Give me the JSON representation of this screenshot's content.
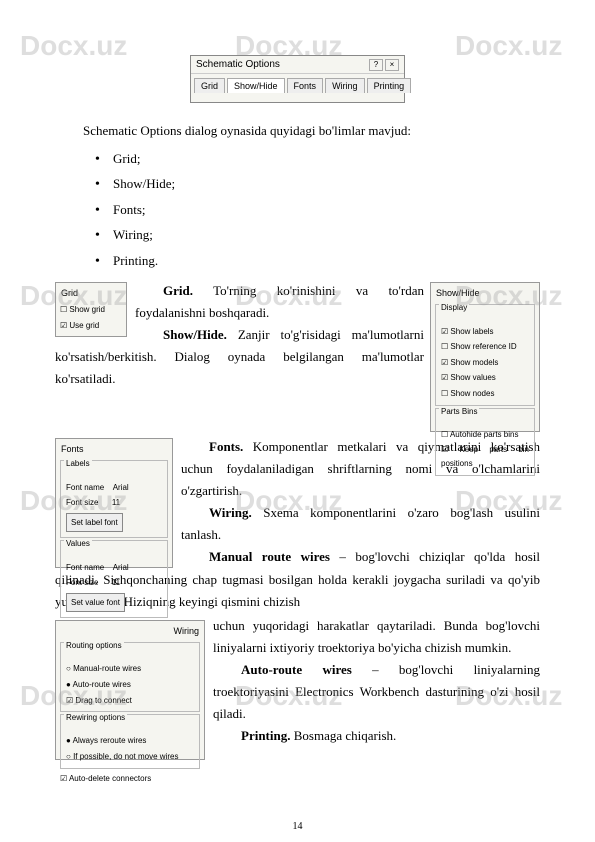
{
  "watermark": "Docx.uz",
  "schematic_dialog": {
    "title": "Schematic Options",
    "tabs": [
      "Grid",
      "Show/Hide",
      "Fonts",
      "Wiring",
      "Printing"
    ]
  },
  "intro": "Schematic Options dialog oynasida quyidagi bo'limlar mavjud:",
  "bullets": {
    "b1": "Grid;",
    "b2": "Show/Hide;",
    "b3": "Fonts;",
    "b4": "Wiring;",
    "b5": "Printing."
  },
  "sections": {
    "grid": {
      "title": "Grid.",
      "text": "To'rning ko'rinishini va to'rdan foydalanishni boshqaradi."
    },
    "showhide": {
      "title": "Show/Hide.",
      "text": "Zanjir to'g'risidagi ma'lumotlarni ko'rsatish/berkitish. Dialog oynada belgilangan ma'lumotlar ko'rsatiladi."
    },
    "fonts": {
      "title": "Fonts.",
      "text": "Komponentlar metkalari va qiymatlarini ko'rsatish uchun foydalaniladigan shriftlarning nomi va o'lchamlarini o'zgartirish."
    },
    "wiring": {
      "title": "Wiring.",
      "text": "Sxema komponentlarini o'zaro bog'lash usulini tanlash."
    },
    "manual": {
      "title": "Manual route wires",
      "text1": " – bog'lovchi chiziqlar qo'lda hosil qilinadi. Sichqonchaning chap tugmasi bosilgan holda kerakli joygacha suriladi va qo'yib yuboriladi. CHiziqning keyingi qismini chizish",
      "text2": "uchun yuqoridagi harakatlar qaytariladi. Bunda bog'lovchi liniyalarni ixtiyoriy troektoriya bo'yicha chizish mumkin."
    },
    "auto": {
      "title": "Auto-route wires",
      "text": " – bog'lovchi liniyalarning troektoriyasini Electronics Workbench dasturining o'zi hosil qiladi."
    },
    "printing": {
      "title": "Printing.",
      "text": "Bosmaga chiqarish."
    }
  },
  "panels": {
    "grid": {
      "title": "Grid",
      "items": [
        "Show grid",
        "Use grid"
      ]
    },
    "showhide": {
      "title": "Show/Hide",
      "group1": "Display",
      "items1": [
        "Show labels",
        "Show reference ID",
        "Show models",
        "Show values",
        "Show nodes"
      ],
      "group2": "Parts Bins",
      "items2": [
        "Autohide parts bins",
        "Keep parts bin positions"
      ]
    },
    "fonts": {
      "title": "Fonts",
      "group1": "Labels",
      "items1_label": "Font name",
      "items1_value": "Arial",
      "items1_size_label": "Font size",
      "items1_size_value": "11",
      "btn1": "Set label font",
      "group2": "Values",
      "btn2": "Set value font"
    },
    "wiring": {
      "title": "Wiring",
      "group1": "Routing options",
      "items1": [
        "Manual-route wires",
        "Auto-route wires",
        "Drag to connect"
      ],
      "group2": "Rewiring options",
      "items2": [
        "Always reroute wires",
        "If possible, do not move wires"
      ],
      "item3": "Auto-delete connectors"
    }
  },
  "pagenum": "14"
}
